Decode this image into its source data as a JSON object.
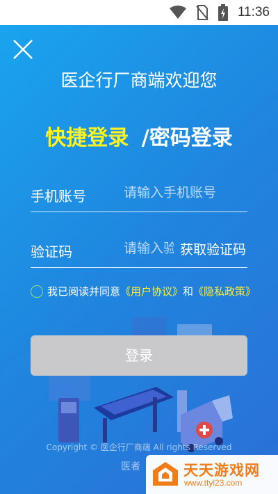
{
  "status_bar": {
    "time": "11:36",
    "icons": [
      "wifi-icon",
      "no-sim-icon",
      "battery-charging-icon"
    ]
  },
  "header": {
    "close_icon": "close-icon",
    "welcome": "医企行厂商端欢迎您"
  },
  "login_modes": {
    "quick": "快捷登录",
    "separator": "/",
    "password": "密码登录",
    "active": "quick"
  },
  "form": {
    "phone": {
      "label": "手机账号",
      "placeholder": "请输入手机账号"
    },
    "code": {
      "label": "验证码",
      "placeholder": "请输入验证码",
      "get_code": "获取验证码"
    }
  },
  "agreement": {
    "checked": false,
    "prefix": "我已阅读并同意",
    "user_agreement": "《用户协议》",
    "and": "和",
    "privacy_policy": "《隐私政策》"
  },
  "login_button": "登录",
  "footer": {
    "copyright": "Copyright © 医企行厂商端 All rights Reserved",
    "line2": "医者"
  },
  "watermark": {
    "name": "天天游戏网",
    "url": "www.ttyl23.com"
  },
  "colors": {
    "accent_yellow": "#fff31e",
    "button_gray": "#c9c9cb",
    "watermark_orange": "#f07d1a"
  }
}
